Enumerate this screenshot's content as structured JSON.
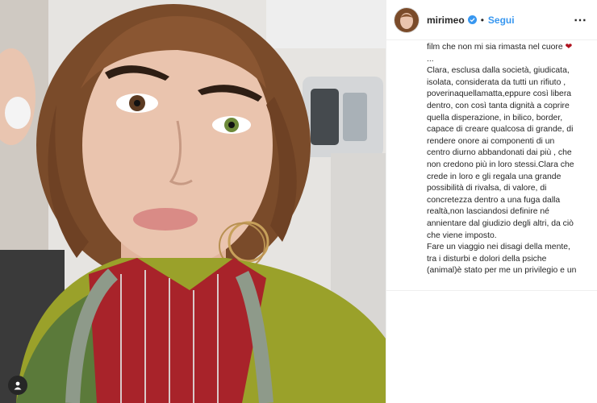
{
  "post": {
    "username": "mirimeo",
    "separator": "•",
    "follow_label": "Segui",
    "more_icon": "⋯",
    "caption_lines": [
      "film che non mi sia rimasta nel cuore",
      "...",
      "Clara, esclusa dalla società, giudicata,",
      "isolata, considerata da tutti un rifiuto ,",
      "poverinaquellamatta,eppure così libera",
      "dentro, con così tanta dignità a coprire",
      "quella disperazione, in bilico, border,",
      "capace di creare qualcosa di grande, di",
      "rendere onore ai componenti di un",
      "centro diurno abbandonati dai più , che",
      "non credono più in loro stessi.Clara che",
      "crede in loro e gli regala una grande",
      "possibilità di rivalsa, di valore, di",
      "concretezza dentro a una fuga dalla",
      "realtà,non lasciandosi definire né",
      "annientare dal giudizio degli altri, da ciò",
      "che viene imposto.",
      "Fare un viaggio nei disagi della mente,",
      "tra i disturbi e dolori della psiche",
      "(animal)è stato per me un privilegio e un"
    ]
  },
  "colors": {
    "accent": "#3897f0",
    "heart": "#b0121f",
    "text": "#262626"
  },
  "icons": {
    "verified": "verified-badge-icon",
    "heart": "heart-icon",
    "user_tag": "user-tag-icon",
    "more": "more-options-icon"
  }
}
